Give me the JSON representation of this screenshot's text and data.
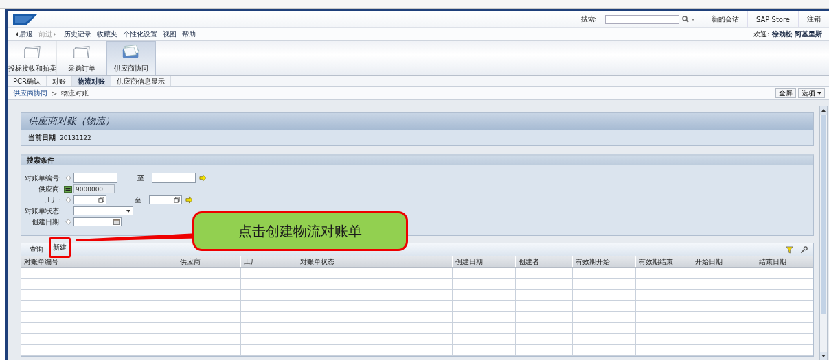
{
  "header": {
    "search_label": "搜索:",
    "links": [
      "新的会话",
      "SAP Store",
      "注销"
    ]
  },
  "menu": {
    "back": "后退",
    "forward": "前进",
    "items": [
      "历史记录",
      "收藏夹",
      "个性化设置",
      "视图",
      "帮助"
    ],
    "welcome": "欢迎:",
    "user": "徐劲松 阿基里斯"
  },
  "nav_tabs": [
    {
      "label": "投标接收和拍卖",
      "selected": false
    },
    {
      "label": "采购订单",
      "selected": false
    },
    {
      "label": "供应商协同",
      "selected": true
    }
  ],
  "sub_tabs": [
    {
      "label": "PCR确认",
      "selected": false
    },
    {
      "label": "对账",
      "selected": false
    },
    {
      "label": "物流对账",
      "selected": true
    },
    {
      "label": "供应商信息显示",
      "selected": false
    }
  ],
  "breadcrumb": {
    "items": [
      "供应商协同",
      "物流对账"
    ],
    "separator": ">"
  },
  "page_buttons": {
    "fullscreen": "全屏",
    "options": "选项"
  },
  "page": {
    "title": "供应商对账（物流）",
    "date_label": "当前日期",
    "date_value": "20131122"
  },
  "search_criteria": {
    "title": "搜索条件",
    "fields": [
      {
        "label": "对账单编号:",
        "operator": {
          "kind": "diamond"
        },
        "kind": "range",
        "to_label": "至"
      },
      {
        "label": "供应商:",
        "operator": {
          "kind": "equal"
        },
        "kind": "readonly",
        "value": "9000000"
      },
      {
        "label": "工厂:",
        "operator": {
          "kind": "diamond"
        },
        "kind": "range_lookup",
        "to_label": "至"
      },
      {
        "label": "对账单状态:",
        "kind": "dropdown"
      },
      {
        "label": "创建日期:",
        "operator": {
          "kind": "diamond"
        },
        "kind": "date"
      }
    ]
  },
  "table": {
    "buttons": [
      {
        "label": "查询",
        "highlighted": false
      },
      {
        "label": "新建",
        "highlighted": true
      }
    ],
    "columns": [
      "对账单编号",
      "供应商",
      "工厂",
      "对账单状态",
      "创建日期",
      "创建者",
      "有效期开始",
      "有效期结束",
      "开始日期",
      "结束日期"
    ]
  },
  "annotation": {
    "text": "点击创建物流对账单"
  }
}
